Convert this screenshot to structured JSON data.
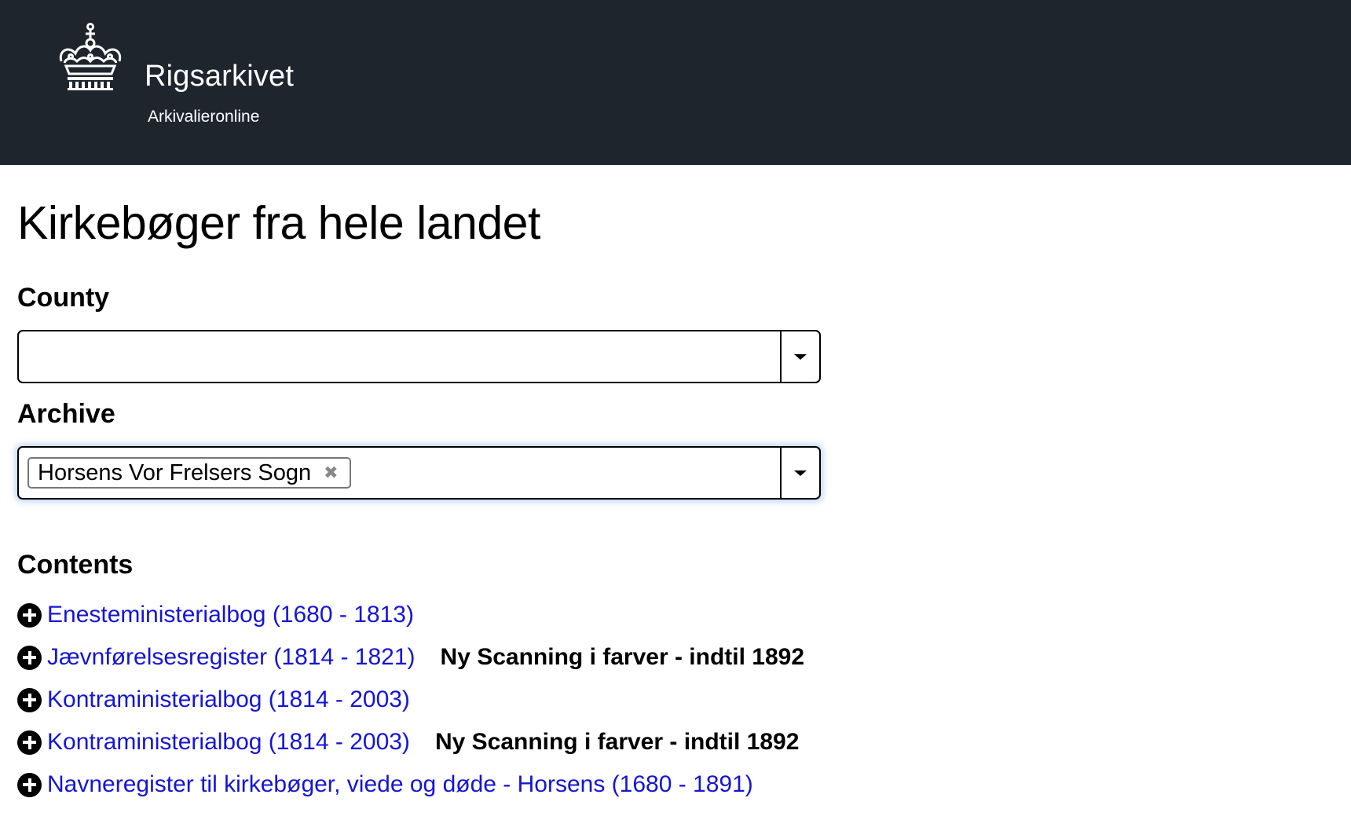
{
  "header": {
    "brand_name": "Rigsarkivet",
    "brand_sub": "Arkivalieronline",
    "background": "#1f252d"
  },
  "page": {
    "title": "Kirkebøger fra hele landet"
  },
  "filters": {
    "county_label": "County",
    "county_value": "",
    "archive_label": "Archive",
    "archive_selected": "Horsens Vor Frelsers Sogn"
  },
  "contents": {
    "title": "Contents",
    "items": [
      {
        "label": "Enesteministerialbog (1680 - 1813)",
        "note": ""
      },
      {
        "label": "Jævnførelsesregister (1814 - 1821)",
        "note": "Ny Scanning i farver - indtil 1892"
      },
      {
        "label": "Kontraministerialbog (1814 - 2003)",
        "note": ""
      },
      {
        "label": "Kontraministerialbog (1814 - 2003)",
        "note": "Ny Scanning i farver - indtil 1892"
      },
      {
        "label": "Navneregister til kirkebøger, viede og døde - Horsens (1680 - 1891)",
        "note": ""
      }
    ],
    "link_color": "#1515d6",
    "icon": "plus-circle-icon"
  }
}
